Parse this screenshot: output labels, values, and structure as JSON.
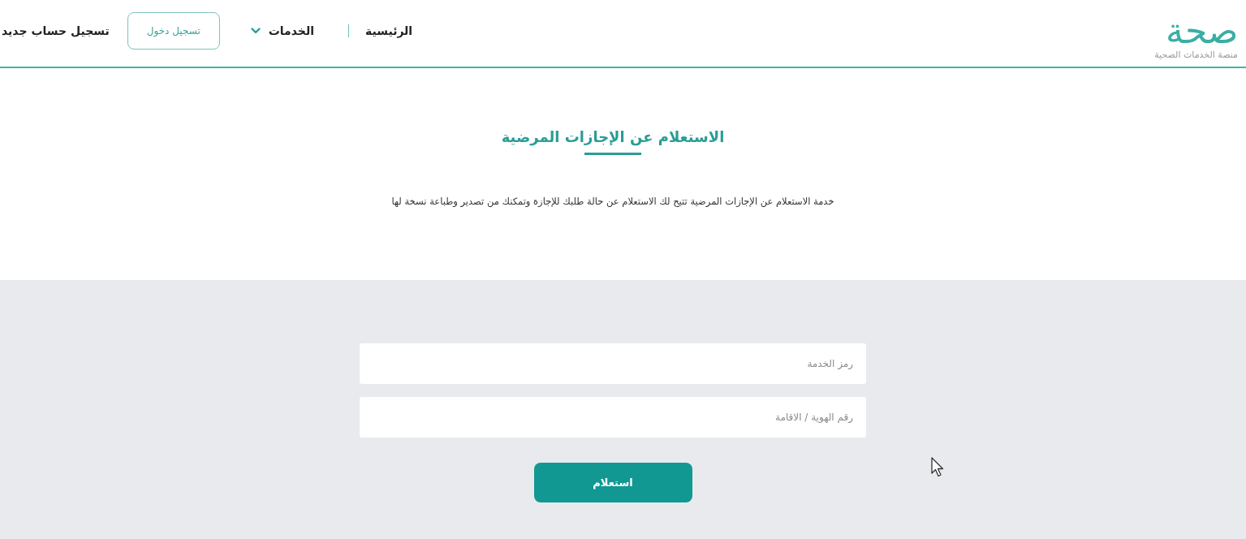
{
  "header": {
    "logo": {
      "name": "صحة",
      "tagline": "منصة الخدمات الصحية"
    },
    "nav": [
      {
        "label": "الرئيسية",
        "kind": "link"
      },
      {
        "label": "الخدمات",
        "kind": "dropdown"
      }
    ],
    "login_button": "تسجيل دخول",
    "register_link": "تسجيل حساب جديد"
  },
  "page": {
    "title": "الاستعلام عن الإجازات المرضية",
    "description": "خدمة الاستعلام عن الإجازات المرضية تتيح لك الاستعلام عن حالة طلبك للإجازة وتمكنك من تصدير وطباعة نسخة لها"
  },
  "form": {
    "fields": [
      {
        "placeholder": "رمز الخدمة"
      },
      {
        "placeholder": "رقم الهوية / الاقامة"
      }
    ],
    "submit": "استعلام"
  }
}
